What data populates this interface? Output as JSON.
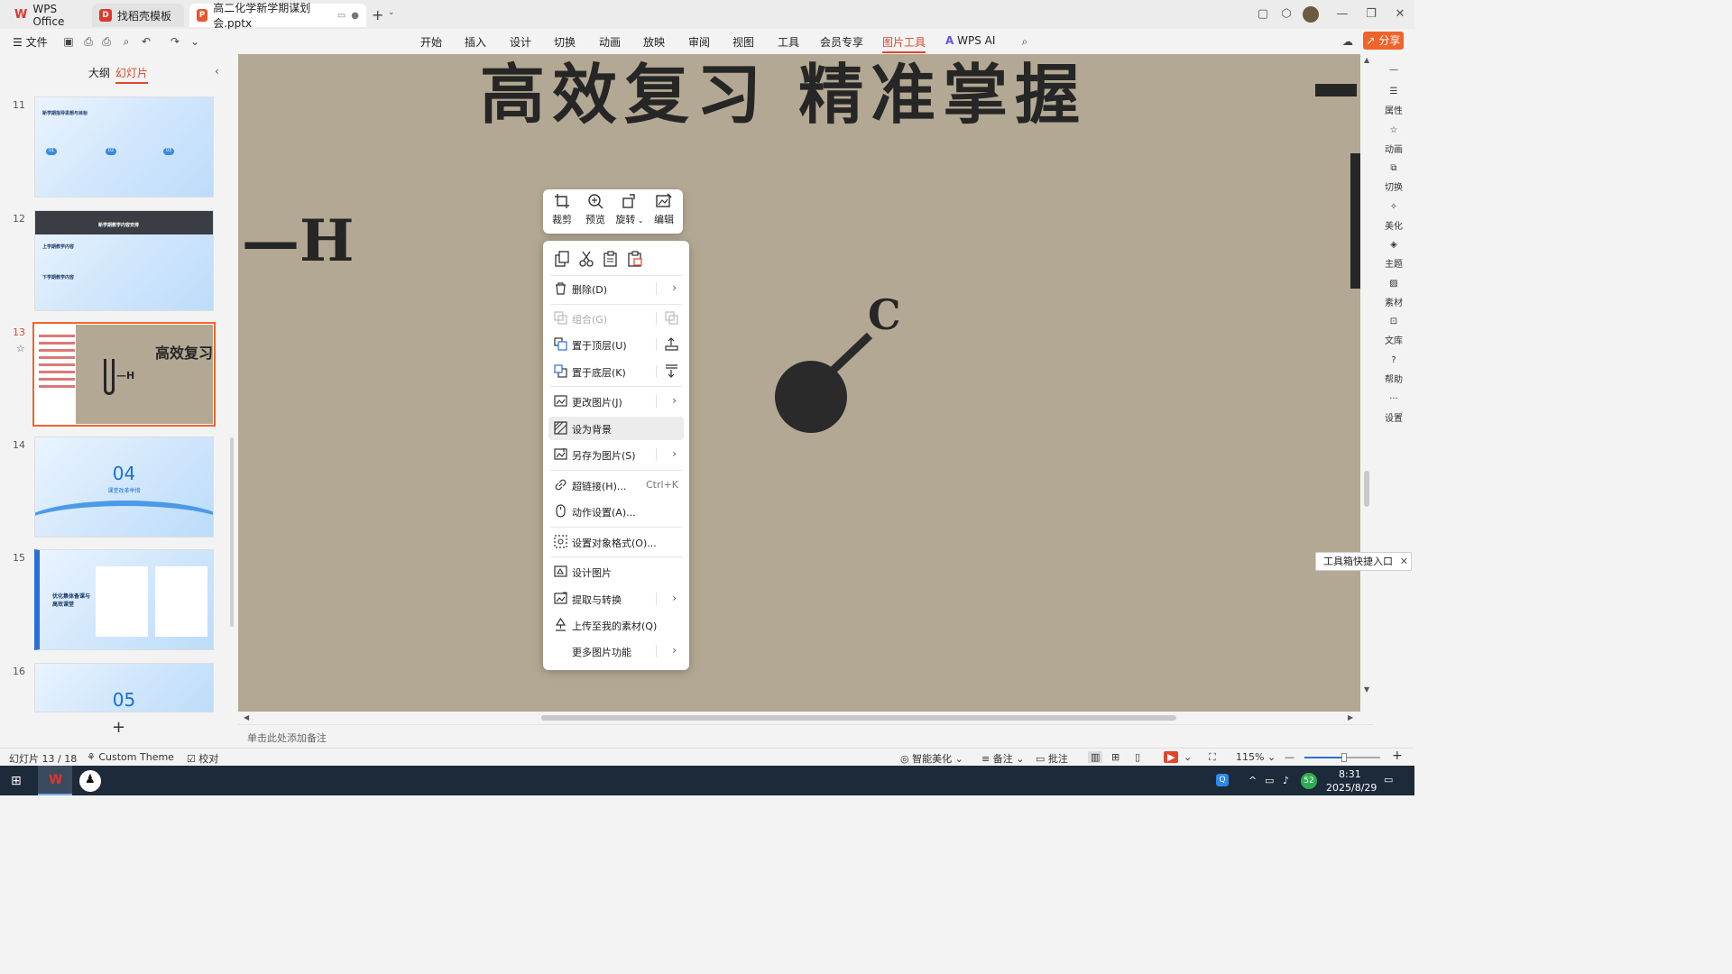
{
  "titlebar": {
    "tabs": [
      {
        "label": "WPS Office"
      },
      {
        "label": "找稻壳模板"
      },
      {
        "label": "高二化学新学期谋划会.pptx"
      }
    ]
  },
  "menubar": {
    "file_label": "文件",
    "items": [
      "开始",
      "插入",
      "设计",
      "切换",
      "动画",
      "放映",
      "审阅",
      "视图",
      "工具",
      "会员专享",
      "图片工具",
      "WPS AI"
    ],
    "active": "图片工具",
    "share_label": "分享"
  },
  "leftpanel": {
    "tabs": [
      "大纲",
      "幻灯片"
    ],
    "active_tab": "幻灯片",
    "slides": [
      {
        "num": "11",
        "title": "新学期指导思想与目标",
        "items": [
          "01",
          "02",
          "03"
        ]
      },
      {
        "num": "12",
        "title": "新学期教学内容安排",
        "sub1": "上学期教学内容",
        "sub2": "下学期教学内容"
      },
      {
        "num": "13",
        "title": "高效复习"
      },
      {
        "num": "14",
        "big": "04",
        "sub": "课堂改革举措"
      },
      {
        "num": "15",
        "title": "优化集体备课与高效课堂"
      },
      {
        "num": "16",
        "big": "05"
      }
    ]
  },
  "canvas": {
    "headline": "高效复习  精准掌握",
    "formula_h": "—H",
    "formula_c": "C"
  },
  "floatbar": {
    "items": [
      "裁剪",
      "预览",
      "旋转",
      "编辑"
    ]
  },
  "context_menu": {
    "items": [
      {
        "label": "删除(D)",
        "arrow": true
      },
      {
        "label": "组合(G)",
        "disabled": true
      },
      {
        "label": "置于顶层(U)"
      },
      {
        "label": "置于底层(K)"
      },
      {
        "label": "更改图片(J)",
        "arrow": true
      },
      {
        "label": "设为背景",
        "highlighted": true
      },
      {
        "label": "另存为图片(S)",
        "arrow": true
      },
      {
        "label": "超链接(H)...",
        "shortcut": "Ctrl+K"
      },
      {
        "label": "动作设置(A)..."
      },
      {
        "label": "设置对象格式(O)..."
      },
      {
        "label": "设计图片"
      },
      {
        "label": "提取与转换",
        "arrow": true
      },
      {
        "label": "上传至我的素材(Q)"
      },
      {
        "label": "更多图片功能",
        "arrow": true
      }
    ]
  },
  "rightbar": {
    "items": [
      "属性",
      "动画",
      "切换",
      "美化",
      "主题",
      "素材",
      "文库",
      "帮助",
      "设置"
    ]
  },
  "tooltip": {
    "label": "工具箱快捷入口"
  },
  "notes": {
    "placeholder": "单击此处添加备注"
  },
  "statusbar": {
    "slide_info": "幻灯片 13 / 18",
    "theme": "Custom Theme",
    "proofread": "校对",
    "beautify": "智能美化",
    "notes": "备注",
    "comments": "批注",
    "zoom": "115%"
  },
  "taskbar": {
    "time": "8:31",
    "date": "2025/8/29",
    "badge": "52"
  },
  "colors": {
    "accent": "#e0462c",
    "share": "#f0642a",
    "taskbar": "#1d2a3a"
  }
}
